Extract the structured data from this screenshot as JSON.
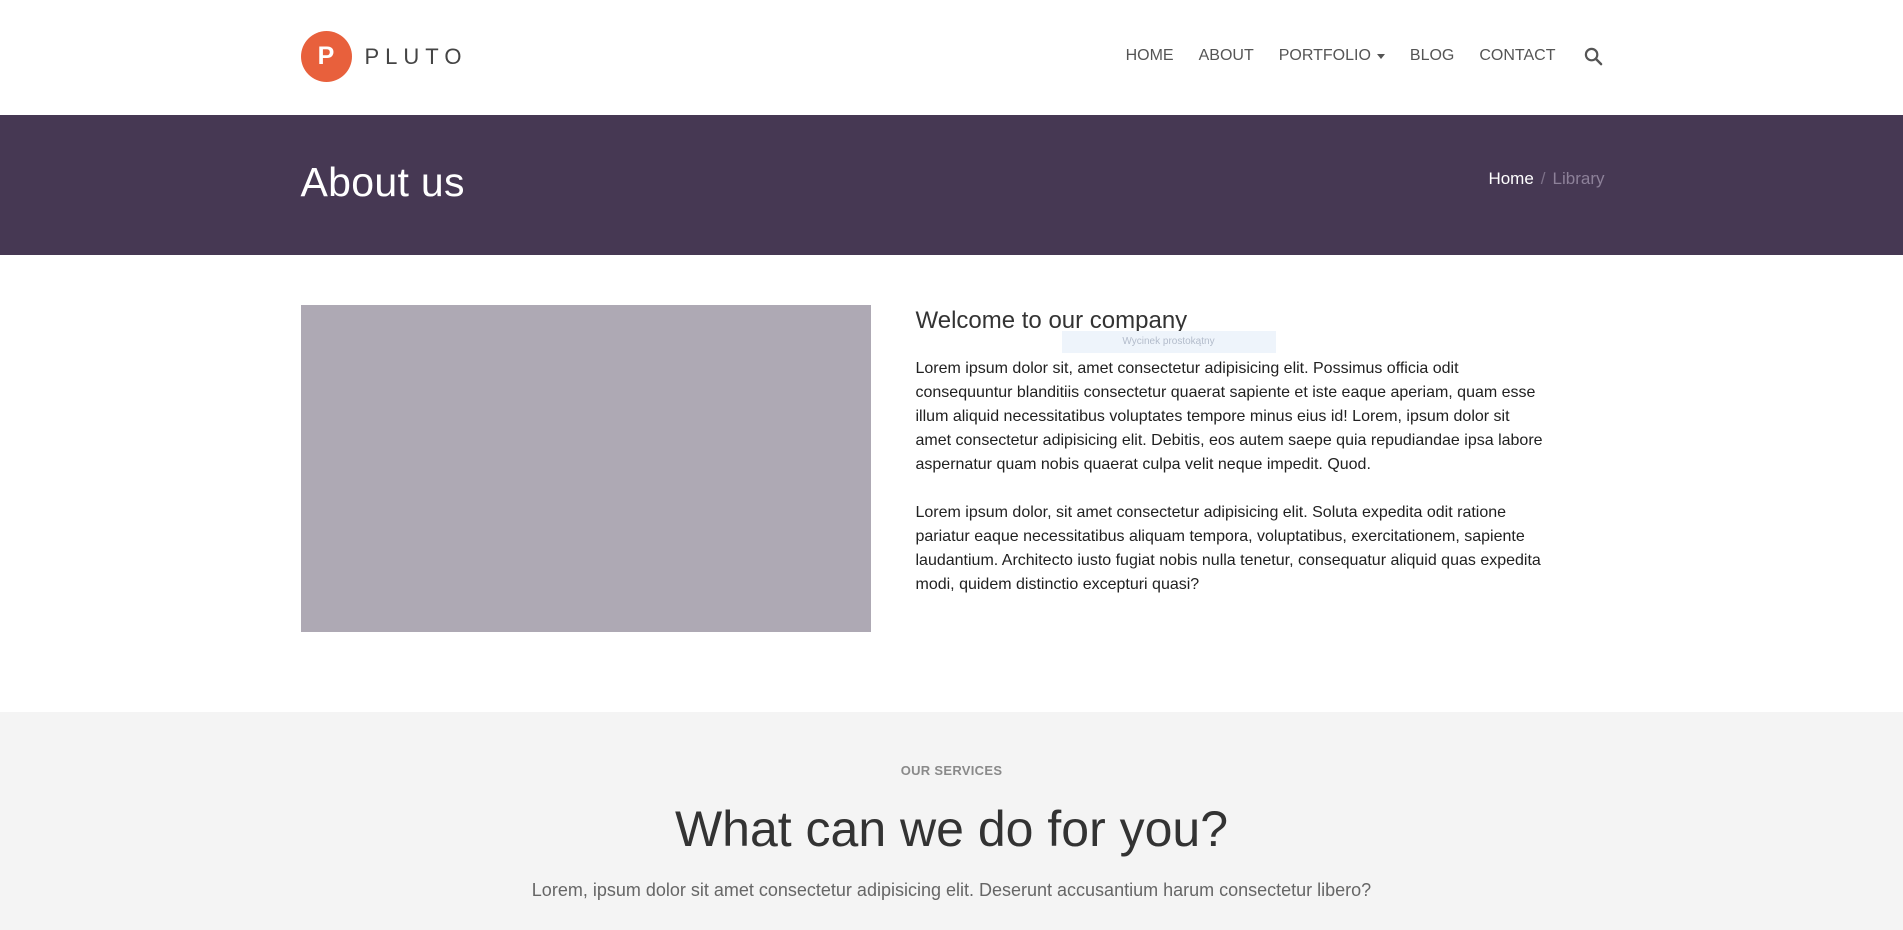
{
  "brand": {
    "logo_letter": "P",
    "name": "PLUTO",
    "accent_color": "#e8603c"
  },
  "nav": {
    "items": [
      {
        "label": "HOME"
      },
      {
        "label": "ABOUT"
      },
      {
        "label": "PORTFOLIO",
        "has_dropdown": true
      },
      {
        "label": "BLOG"
      },
      {
        "label": "CONTACT"
      }
    ],
    "search_icon": "search-icon"
  },
  "banner": {
    "title": "About us",
    "background_color": "#463853",
    "breadcrumb": {
      "home": "Home",
      "separator": "/",
      "current": "Library"
    }
  },
  "about": {
    "heading": "Welcome to our company",
    "tooltip": "Wycinek prostokątny",
    "paragraphs": [
      "Lorem ipsum dolor sit, amet consectetur adipisicing elit. Possimus officia odit consequuntur blanditiis consectetur quaerat sapiente et iste eaque aperiam, quam esse illum aliquid necessitatibus voluptates tempore minus eius id! Lorem, ipsum dolor sit amet consectetur adipisicing elit. Debitis, eos autem saepe quia repudiandae ipsa labore aspernatur quam nobis quaerat culpa velit neque impedit. Quod.",
      "Lorem ipsum dolor, sit amet consectetur adipisicing elit. Soluta expedita odit ratione pariatur eaque necessitatibus aliquam tempora, voluptatibus, exercitationem, sapiente laudantium. Architecto iusto fugiat nobis nulla tenetur, consequatur aliquid quas expedita modi, quidem distinctio excepturi quasi?"
    ]
  },
  "services": {
    "eyebrow": "OUR SERVICES",
    "title": "What can we do for you?",
    "subtitle": "Lorem, ipsum dolor sit amet consectetur adipisicing elit. Deserunt accusantium harum consectetur libero?"
  }
}
